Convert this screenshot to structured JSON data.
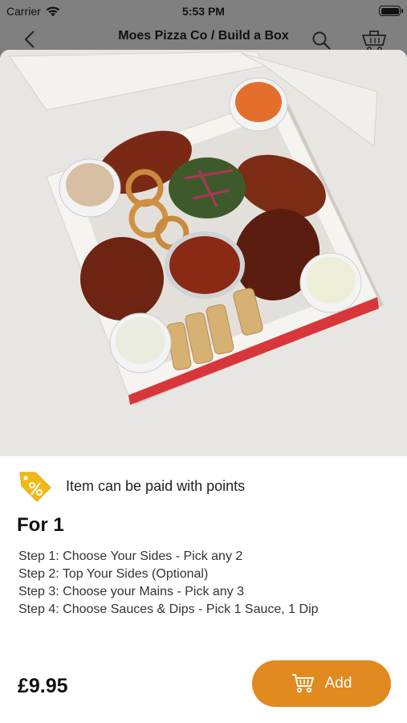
{
  "status_bar": {
    "carrier": "Carrier",
    "time": "5:53 PM"
  },
  "header": {
    "title": "Moes Pizza Co / Build a Box"
  },
  "icons": {
    "back": "chevron-left-icon",
    "search": "search-icon",
    "cart": "basket-icon",
    "points_tag": "discount-tag-icon",
    "add_cart": "cart-icon"
  },
  "colors": {
    "accent": "#E08A1F",
    "points_tag": "#F2B915",
    "overlay": "#808080"
  },
  "points": {
    "label": "Item can be paid with points"
  },
  "product": {
    "name": "For 1",
    "steps": [
      "Step 1: Choose Your Sides - Pick any 2",
      "Step 2: Top Your Sides (Optional)",
      "Step 3: Choose your Mains - Pick any 3",
      "Step 4: Choose Sauces & Dips - Pick 1 Sauce, 1 Dip"
    ],
    "price": "£9.95"
  },
  "actions": {
    "add_label": "Add"
  }
}
